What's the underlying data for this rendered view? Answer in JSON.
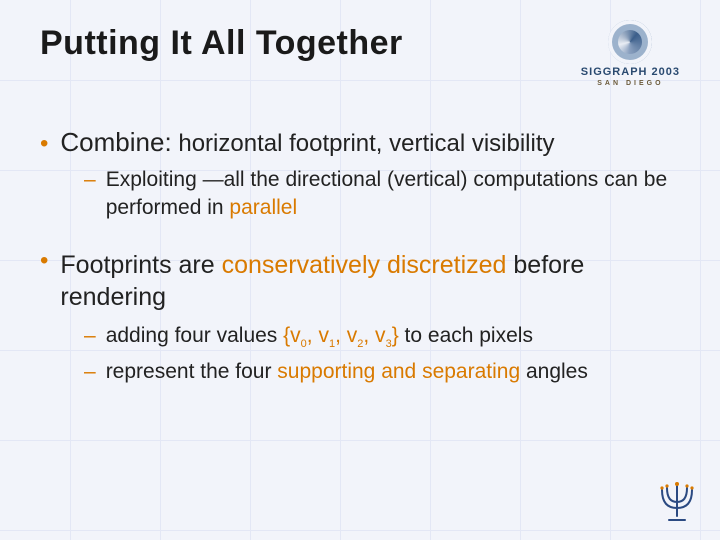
{
  "title": "Putting It All Together",
  "logo": {
    "line1": "SIGGRAPH 2003",
    "line2": "SAN DIEGO"
  },
  "bullets": [
    {
      "lead": "Combine:",
      "rest": " horizontal footprint, vertical visibility",
      "subs": [
        {
          "pre": "Exploiting ",
          "mid": "—",
          "tail1": "all the directional (vertical) computations can be performed in ",
          "hl": "parallel"
        }
      ]
    },
    {
      "line_pre": "Footprints are ",
      "line_hl": "conservatively discretized",
      "line_post": " before rendering",
      "subs": [
        {
          "pre": "adding four values ",
          "vset": "{v₀, v₁, v₂, v₃}",
          "post": " to each pixels"
        },
        {
          "pre": "represent the four ",
          "hl": "supporting and separating",
          "post": " angles"
        }
      ]
    }
  ]
}
